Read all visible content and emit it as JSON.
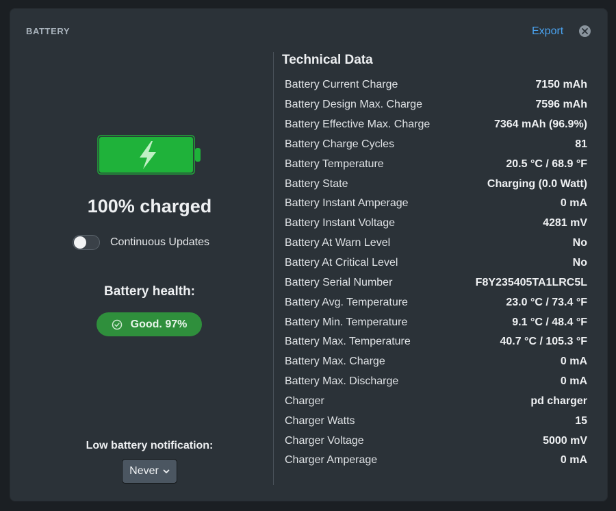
{
  "panel": {
    "title": "BATTERY",
    "export_label": "Export",
    "close_icon": "close-icon"
  },
  "status": {
    "charge_level": 1.0,
    "charged_text": "100% charged",
    "battery_color": "#1fb23a",
    "continuous_updates": {
      "label": "Continuous Updates",
      "enabled": false
    }
  },
  "health": {
    "label": "Battery health:",
    "badge_text": "Good. 97%",
    "badge_icon": "check-circle-icon",
    "badge_color": "#2f8f3c"
  },
  "notification": {
    "label": "Low battery notification:",
    "selected": "Never"
  },
  "technical": {
    "title": "Technical Data",
    "rows": [
      {
        "key": "Battery Current Charge",
        "value": "7150 mAh"
      },
      {
        "key": "Battery Design Max. Charge",
        "value": "7596 mAh"
      },
      {
        "key": "Battery Effective Max. Charge",
        "value": "7364 mAh (96.9%)"
      },
      {
        "key": "Battery Charge Cycles",
        "value": "81"
      },
      {
        "key": "Battery Temperature",
        "value": "20.5 °C / 68.9 °F"
      },
      {
        "key": "Battery State",
        "value": "Charging (0.0 Watt)"
      },
      {
        "key": "Battery Instant Amperage",
        "value": "0 mA"
      },
      {
        "key": "Battery Instant Voltage",
        "value": "4281 mV"
      },
      {
        "key": "Battery At Warn Level",
        "value": "No"
      },
      {
        "key": "Battery At Critical Level",
        "value": "No"
      },
      {
        "key": "Battery Serial Number",
        "value": "F8Y235405TA1LRC5L"
      },
      {
        "key": "Battery Avg. Temperature",
        "value": "23.0 °C / 73.4 °F"
      },
      {
        "key": "Battery Min. Temperature",
        "value": "9.1 °C / 48.4 °F"
      },
      {
        "key": "Battery Max. Temperature",
        "value": "40.7 °C / 105.3 °F"
      },
      {
        "key": "Battery Max. Charge",
        "value": "0 mA"
      },
      {
        "key": "Battery Max. Discharge",
        "value": "0 mA"
      },
      {
        "key": "Charger",
        "value": "pd charger"
      },
      {
        "key": "Charger Watts",
        "value": "15"
      },
      {
        "key": "Charger Voltage",
        "value": "5000 mV"
      },
      {
        "key": "Charger Amperage",
        "value": "0 mA"
      }
    ]
  }
}
